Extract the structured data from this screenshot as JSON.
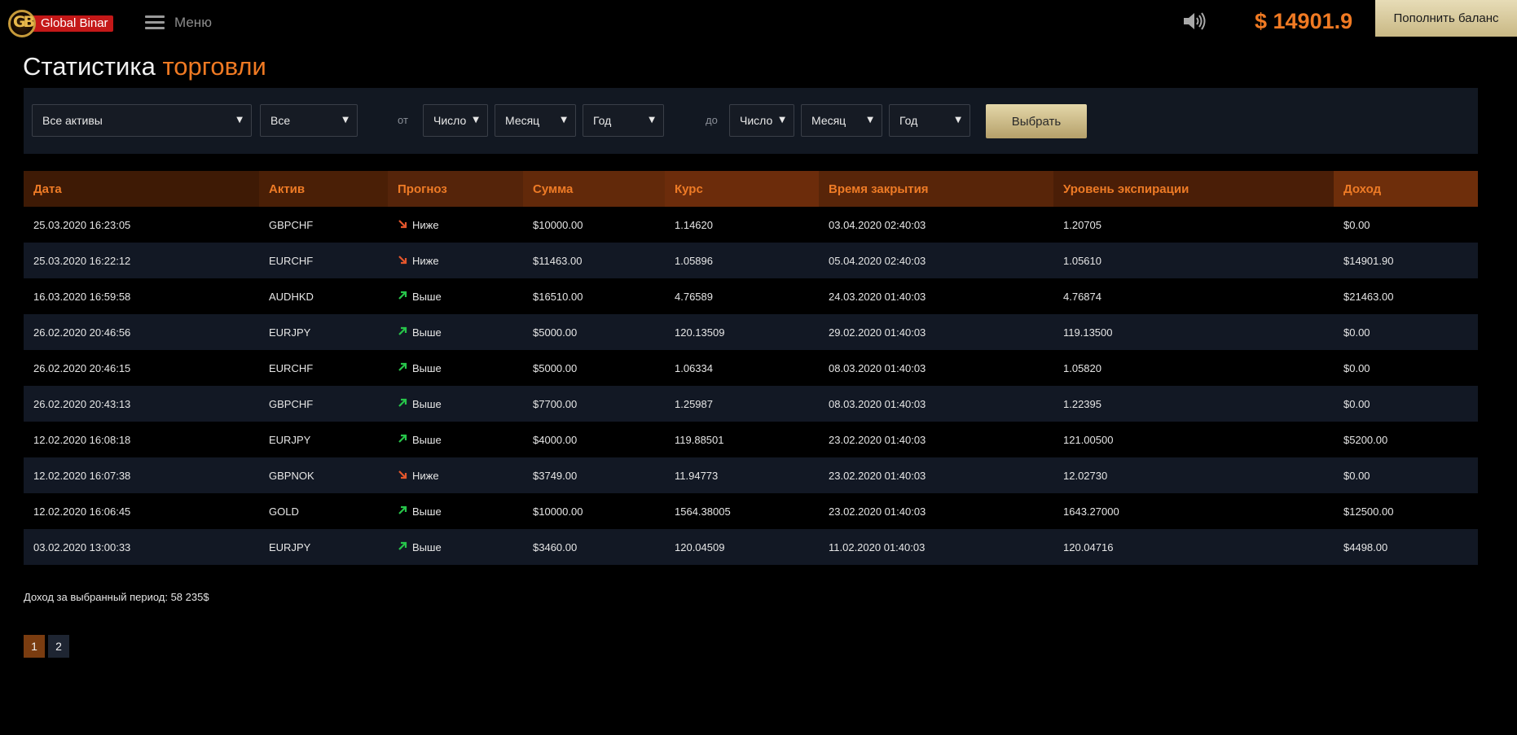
{
  "header": {
    "logo_letters": "GB",
    "logo_text": "Global Binar",
    "menu_label": "Меню",
    "balance": "$ 14901.9",
    "topup_label": "Пополнить баланс"
  },
  "page": {
    "title_main": "Статистика",
    "title_accent": "торговли"
  },
  "filters": {
    "asset": "Все активы",
    "type": "Все",
    "from_label": "от",
    "to_label": "до",
    "from_day": "Число",
    "from_month": "Месяц",
    "from_year": "Год",
    "to_day": "Число",
    "to_month": "Месяц",
    "to_year": "Год",
    "submit_label": "Выбрать"
  },
  "table": {
    "header_colors": [
      "#3e1a05",
      "#4a1f06",
      "#55240a",
      "#62290a",
      "#6c2c0b",
      "#582509",
      "#4a1e07",
      "#6e2e0b"
    ],
    "columns": [
      "Дата",
      "Актив",
      "Прогноз",
      "Сумма",
      "Курс",
      "Время закрытия",
      "Уровень экспирации",
      "Доход"
    ],
    "rows": [
      {
        "date": "25.03.2020 16:23:05",
        "asset": "GBPCHF",
        "dir": "down",
        "forecast": "Ниже",
        "amount": "$10000.00",
        "rate": "1.14620",
        "close": "03.04.2020 02:40:03",
        "expiry": "1.20705",
        "income": "$0.00"
      },
      {
        "date": "25.03.2020 16:22:12",
        "asset": "EURCHF",
        "dir": "down",
        "forecast": "Ниже",
        "amount": "$11463.00",
        "rate": "1.05896",
        "close": "05.04.2020 02:40:03",
        "expiry": "1.05610",
        "income": "$14901.90"
      },
      {
        "date": "16.03.2020 16:59:58",
        "asset": "AUDHKD",
        "dir": "up",
        "forecast": "Выше",
        "amount": "$16510.00",
        "rate": "4.76589",
        "close": "24.03.2020 01:40:03",
        "expiry": "4.76874",
        "income": "$21463.00"
      },
      {
        "date": "26.02.2020 20:46:56",
        "asset": "EURJPY",
        "dir": "up",
        "forecast": "Выше",
        "amount": "$5000.00",
        "rate": "120.13509",
        "close": "29.02.2020 01:40:03",
        "expiry": "119.13500",
        "income": "$0.00"
      },
      {
        "date": "26.02.2020 20:46:15",
        "asset": "EURCHF",
        "dir": "up",
        "forecast": "Выше",
        "amount": "$5000.00",
        "rate": "1.06334",
        "close": "08.03.2020 01:40:03",
        "expiry": "1.05820",
        "income": "$0.00"
      },
      {
        "date": "26.02.2020 20:43:13",
        "asset": "GBPCHF",
        "dir": "up",
        "forecast": "Выше",
        "amount": "$7700.00",
        "rate": "1.25987",
        "close": "08.03.2020 01:40:03",
        "expiry": "1.22395",
        "income": "$0.00"
      },
      {
        "date": "12.02.2020 16:08:18",
        "asset": "EURJPY",
        "dir": "up",
        "forecast": "Выше",
        "amount": "$4000.00",
        "rate": "119.88501",
        "close": "23.02.2020 01:40:03",
        "expiry": "121.00500",
        "income": "$5200.00"
      },
      {
        "date": "12.02.2020 16:07:38",
        "asset": "GBPNOK",
        "dir": "down",
        "forecast": "Ниже",
        "amount": "$3749.00",
        "rate": "11.94773",
        "close": "23.02.2020 01:40:03",
        "expiry": "12.02730",
        "income": "$0.00"
      },
      {
        "date": "12.02.2020 16:06:45",
        "asset": "GOLD",
        "dir": "up",
        "forecast": "Выше",
        "amount": "$10000.00",
        "rate": "1564.38005",
        "close": "23.02.2020 01:40:03",
        "expiry": "1643.27000",
        "income": "$12500.00"
      },
      {
        "date": "03.02.2020 13:00:33",
        "asset": "EURJPY",
        "dir": "up",
        "forecast": "Выше",
        "amount": "$3460.00",
        "rate": "120.04509",
        "close": "11.02.2020 01:40:03",
        "expiry": "120.04716",
        "income": "$4498.00"
      }
    ]
  },
  "summary": {
    "income_text": "Доход за выбранный период: 58 235$"
  },
  "pagination": {
    "pages": [
      "1",
      "2"
    ],
    "active": "1"
  },
  "colors": {
    "accent": "#f07a23",
    "up_arrow": "#27c44a",
    "down_arrow": "#e3562c"
  }
}
